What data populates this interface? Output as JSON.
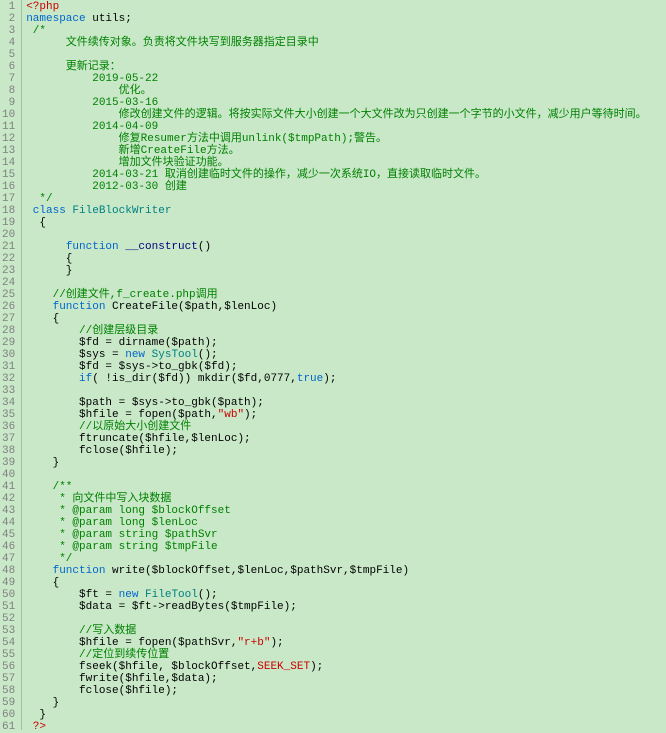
{
  "lines": [
    {
      "n": 1,
      "seg": [
        {
          "c": "k-red",
          "t": "<?php"
        }
      ]
    },
    {
      "n": 2,
      "seg": [
        {
          "c": "k-blue",
          "t": "namespace"
        },
        {
          "c": "k-black",
          "t": " utils;"
        }
      ]
    },
    {
      "n": 3,
      "seg": [
        {
          "c": "k-green",
          "t": " /*"
        }
      ]
    },
    {
      "n": 4,
      "seg": [
        {
          "c": "k-green",
          "t": "      文件续传对象。负责将文件块写到服务器指定目录中"
        }
      ]
    },
    {
      "n": 5,
      "seg": [
        {
          "c": "k-green",
          "t": ""
        }
      ]
    },
    {
      "n": 6,
      "seg": [
        {
          "c": "k-green",
          "t": "      更新记录："
        }
      ]
    },
    {
      "n": 7,
      "seg": [
        {
          "c": "k-green",
          "t": "          2019-05-22"
        }
      ]
    },
    {
      "n": 8,
      "seg": [
        {
          "c": "k-green",
          "t": "              优化。"
        }
      ]
    },
    {
      "n": 9,
      "seg": [
        {
          "c": "k-green",
          "t": "          2015-03-16"
        }
      ]
    },
    {
      "n": 10,
      "seg": [
        {
          "c": "k-green",
          "t": "              修改创建文件的逻辑。将按实际文件大小创建一个大文件改为只创建一个字节的小文件，减少用户等待时间。"
        }
      ]
    },
    {
      "n": 11,
      "seg": [
        {
          "c": "k-green",
          "t": "          2014-04-09"
        }
      ]
    },
    {
      "n": 12,
      "seg": [
        {
          "c": "k-green",
          "t": "              修复Resumer方法中调用unlink($tmpPath);警告。"
        }
      ]
    },
    {
      "n": 13,
      "seg": [
        {
          "c": "k-green",
          "t": "              新增CreateFile方法。"
        }
      ]
    },
    {
      "n": 14,
      "seg": [
        {
          "c": "k-green",
          "t": "              增加文件块验证功能。"
        }
      ]
    },
    {
      "n": 15,
      "seg": [
        {
          "c": "k-green",
          "t": "          2014-03-21 取消创建临时文件的操作，减少一次系统IO，直接读取临时文件。"
        }
      ]
    },
    {
      "n": 16,
      "seg": [
        {
          "c": "k-green",
          "t": "          2012-03-30 创建"
        }
      ]
    },
    {
      "n": 17,
      "seg": [
        {
          "c": "k-green",
          "t": "  */"
        }
      ]
    },
    {
      "n": 18,
      "seg": [
        {
          "c": "k-blue",
          "t": " class"
        },
        {
          "c": "k-teal",
          "t": " FileBlockWriter"
        }
      ]
    },
    {
      "n": 19,
      "seg": [
        {
          "c": "k-black",
          "t": "  {"
        }
      ]
    },
    {
      "n": 20,
      "seg": [
        {
          "c": "k-black",
          "t": ""
        }
      ]
    },
    {
      "n": 21,
      "seg": [
        {
          "c": "k-black",
          "t": "      "
        },
        {
          "c": "k-blue",
          "t": "function"
        },
        {
          "c": "k-navy",
          "t": " __construct"
        },
        {
          "c": "k-black",
          "t": "()"
        }
      ]
    },
    {
      "n": 22,
      "seg": [
        {
          "c": "k-black",
          "t": "      {"
        }
      ]
    },
    {
      "n": 23,
      "seg": [
        {
          "c": "k-black",
          "t": "      }"
        }
      ]
    },
    {
      "n": 24,
      "seg": [
        {
          "c": "k-black",
          "t": ""
        }
      ]
    },
    {
      "n": 25,
      "seg": [
        {
          "c": "k-black",
          "t": "    "
        },
        {
          "c": "k-green",
          "t": "//创建文件,f_create.php调用"
        }
      ]
    },
    {
      "n": 26,
      "seg": [
        {
          "c": "k-black",
          "t": "    "
        },
        {
          "c": "k-blue",
          "t": "function"
        },
        {
          "c": "k-black",
          "t": " CreateFile($path,$lenLoc)"
        }
      ]
    },
    {
      "n": 27,
      "seg": [
        {
          "c": "k-black",
          "t": "    {"
        }
      ]
    },
    {
      "n": 28,
      "seg": [
        {
          "c": "k-black",
          "t": "        "
        },
        {
          "c": "k-green",
          "t": "//创建层级目录"
        }
      ]
    },
    {
      "n": 29,
      "seg": [
        {
          "c": "k-black",
          "t": "        $fd = dirname($path);"
        }
      ]
    },
    {
      "n": 30,
      "seg": [
        {
          "c": "k-black",
          "t": "        $sys = "
        },
        {
          "c": "k-blue",
          "t": "new"
        },
        {
          "c": "k-teal",
          "t": " SysTool"
        },
        {
          "c": "k-black",
          "t": "();"
        }
      ]
    },
    {
      "n": 31,
      "seg": [
        {
          "c": "k-black",
          "t": "        $fd = $sys->to_gbk($fd);"
        }
      ]
    },
    {
      "n": 32,
      "seg": [
        {
          "c": "k-black",
          "t": "        "
        },
        {
          "c": "k-blue",
          "t": "if"
        },
        {
          "c": "k-black",
          "t": "( !is_dir($fd)) mkdir($fd,0777,"
        },
        {
          "c": "k-blue",
          "t": "true"
        },
        {
          "c": "k-black",
          "t": ");"
        }
      ]
    },
    {
      "n": 33,
      "seg": [
        {
          "c": "k-black",
          "t": ""
        }
      ]
    },
    {
      "n": 34,
      "seg": [
        {
          "c": "k-black",
          "t": "        $path = $sys->to_gbk($path);"
        }
      ]
    },
    {
      "n": 35,
      "seg": [
        {
          "c": "k-black",
          "t": "        $hfile = fopen($path,"
        },
        {
          "c": "k-red",
          "t": "\"wb\""
        },
        {
          "c": "k-black",
          "t": ");"
        }
      ]
    },
    {
      "n": 36,
      "seg": [
        {
          "c": "k-black",
          "t": "        "
        },
        {
          "c": "k-green",
          "t": "//以原始大小创建文件"
        }
      ]
    },
    {
      "n": 37,
      "seg": [
        {
          "c": "k-black",
          "t": "        ftruncate($hfile,$lenLoc);"
        }
      ]
    },
    {
      "n": 38,
      "seg": [
        {
          "c": "k-black",
          "t": "        fclose($hfile);"
        }
      ]
    },
    {
      "n": 39,
      "seg": [
        {
          "c": "k-black",
          "t": "    }"
        }
      ]
    },
    {
      "n": 40,
      "seg": [
        {
          "c": "k-black",
          "t": ""
        }
      ]
    },
    {
      "n": 41,
      "seg": [
        {
          "c": "k-black",
          "t": "    "
        },
        {
          "c": "k-green",
          "t": "/**"
        }
      ]
    },
    {
      "n": 42,
      "seg": [
        {
          "c": "k-green",
          "t": "     * 向文件中写入块数据"
        }
      ]
    },
    {
      "n": 43,
      "seg": [
        {
          "c": "k-green",
          "t": "     * @param long $blockOffset"
        }
      ]
    },
    {
      "n": 44,
      "seg": [
        {
          "c": "k-green",
          "t": "     * @param long $lenLoc"
        }
      ]
    },
    {
      "n": 45,
      "seg": [
        {
          "c": "k-green",
          "t": "     * @param string $pathSvr"
        }
      ]
    },
    {
      "n": 46,
      "seg": [
        {
          "c": "k-green",
          "t": "     * @param string $tmpFile"
        }
      ]
    },
    {
      "n": 47,
      "seg": [
        {
          "c": "k-green",
          "t": "     */"
        }
      ]
    },
    {
      "n": 48,
      "seg": [
        {
          "c": "k-black",
          "t": "    "
        },
        {
          "c": "k-blue",
          "t": "function"
        },
        {
          "c": "k-black",
          "t": " write($blockOffset,$lenLoc,$pathSvr,$tmpFile)"
        }
      ]
    },
    {
      "n": 49,
      "seg": [
        {
          "c": "k-black",
          "t": "    {"
        }
      ]
    },
    {
      "n": 50,
      "seg": [
        {
          "c": "k-black",
          "t": "        $ft = "
        },
        {
          "c": "k-blue",
          "t": "new"
        },
        {
          "c": "k-teal",
          "t": " FileTool"
        },
        {
          "c": "k-black",
          "t": "();"
        }
      ]
    },
    {
      "n": 51,
      "seg": [
        {
          "c": "k-black",
          "t": "        $data = $ft->readBytes($tmpFile);"
        }
      ]
    },
    {
      "n": 52,
      "seg": [
        {
          "c": "k-black",
          "t": ""
        }
      ]
    },
    {
      "n": 53,
      "seg": [
        {
          "c": "k-black",
          "t": "        "
        },
        {
          "c": "k-green",
          "t": "//写入数据"
        }
      ]
    },
    {
      "n": 54,
      "seg": [
        {
          "c": "k-black",
          "t": "        $hfile = fopen($pathSvr,"
        },
        {
          "c": "k-red",
          "t": "\"r+b\""
        },
        {
          "c": "k-black",
          "t": ");"
        }
      ]
    },
    {
      "n": 55,
      "seg": [
        {
          "c": "k-black",
          "t": "        "
        },
        {
          "c": "k-green",
          "t": "//定位到续传位置"
        }
      ]
    },
    {
      "n": 56,
      "seg": [
        {
          "c": "k-black",
          "t": "        fseek($hfile, $blockOffset,"
        },
        {
          "c": "k-red",
          "t": "SEEK_SET"
        },
        {
          "c": "k-black",
          "t": ");"
        }
      ]
    },
    {
      "n": 57,
      "seg": [
        {
          "c": "k-black",
          "t": "        fwrite($hfile,$data);"
        }
      ]
    },
    {
      "n": 58,
      "seg": [
        {
          "c": "k-black",
          "t": "        fclose($hfile);"
        }
      ]
    },
    {
      "n": 59,
      "seg": [
        {
          "c": "k-black",
          "t": "    }"
        }
      ]
    },
    {
      "n": 60,
      "seg": [
        {
          "c": "k-black",
          "t": "  }"
        }
      ]
    },
    {
      "n": 61,
      "seg": [
        {
          "c": "k-red",
          "t": " ?>"
        }
      ]
    }
  ],
  "folds": [
    2,
    3,
    18,
    19,
    21,
    22,
    26,
    27,
    41,
    48,
    49
  ]
}
